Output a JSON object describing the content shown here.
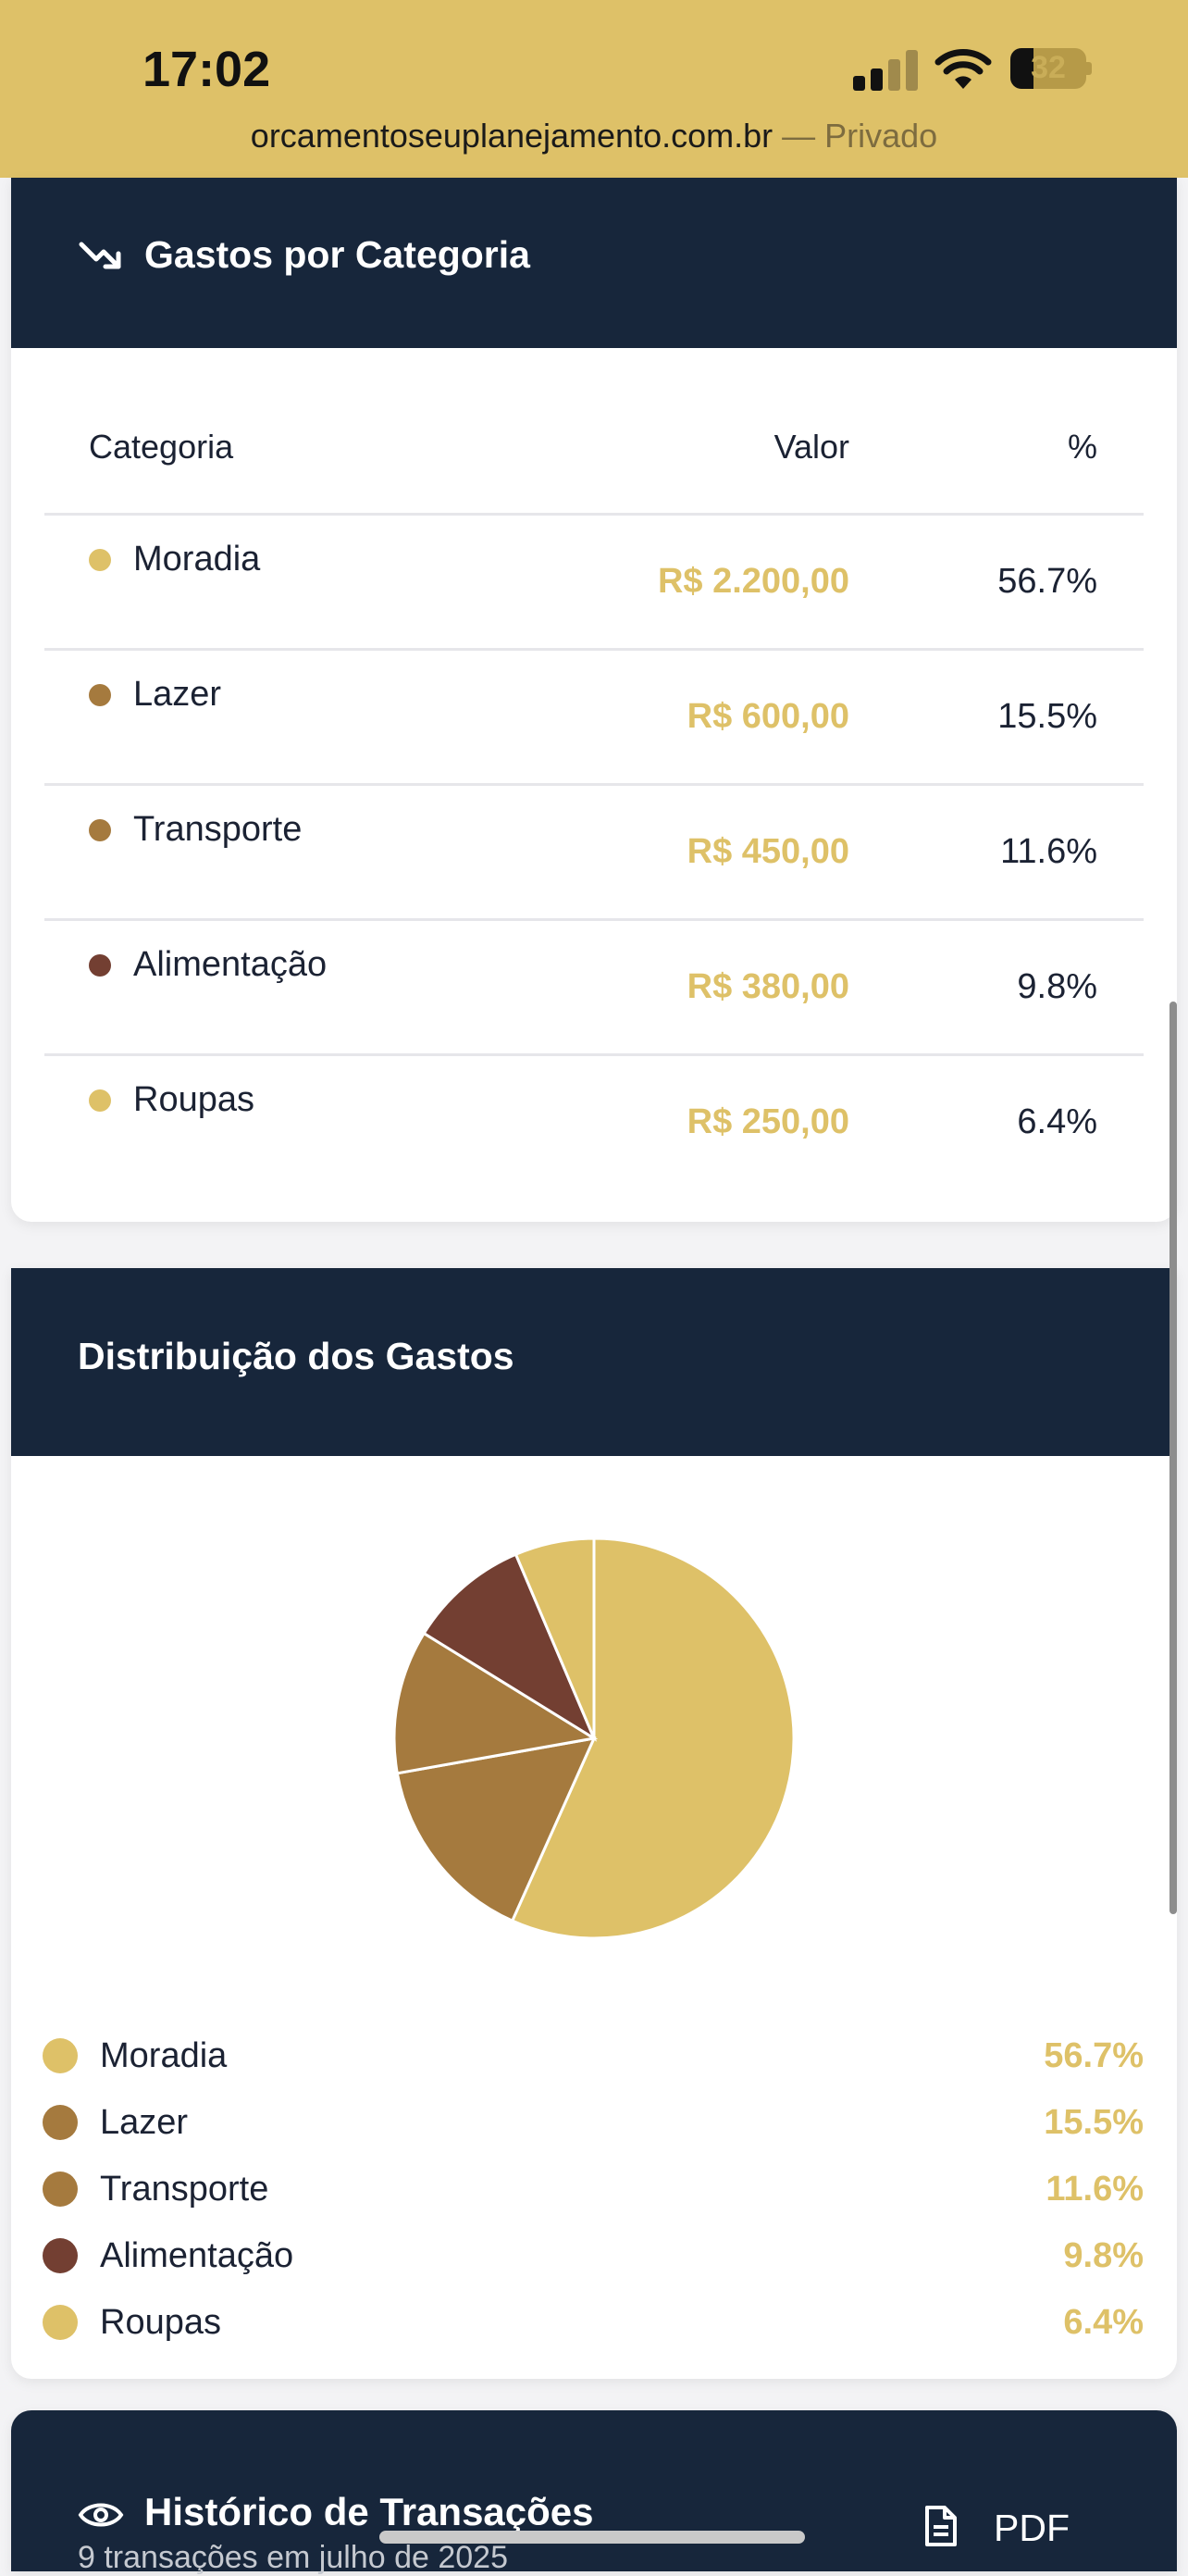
{
  "status_bar": {
    "time": "17:02",
    "battery": "32",
    "url": "orcamentoseuplanejamento.com.br",
    "private_label": "— Privado"
  },
  "category_card": {
    "title": "Gastos por Categoria",
    "icon": "trending-down-icon",
    "columns": {
      "category": "Categoria",
      "value": "Valor",
      "percent": "%"
    },
    "rows": [
      {
        "name": "Moradia",
        "value": "R$ 2.200,00",
        "percent": "56.7%",
        "color": "#dec168"
      },
      {
        "name": "Lazer",
        "value": "R$ 600,00",
        "percent": "15.5%",
        "color": "#a57a3e"
      },
      {
        "name": "Transporte",
        "value": "R$ 450,00",
        "percent": "11.6%",
        "color": "#a57a3e"
      },
      {
        "name": "Alimentação",
        "value": "R$ 380,00",
        "percent": "9.8%",
        "color": "#733f32"
      },
      {
        "name": "Roupas",
        "value": "R$ 250,00",
        "percent": "6.4%",
        "color": "#dec168"
      }
    ]
  },
  "distribution_card": {
    "title": "Distribuição dos Gastos",
    "legend": [
      {
        "name": "Moradia",
        "percent": "56.7%",
        "color": "#dec168"
      },
      {
        "name": "Lazer",
        "percent": "15.5%",
        "color": "#a57a3e"
      },
      {
        "name": "Transporte",
        "percent": "11.6%",
        "color": "#a57a3e"
      },
      {
        "name": "Alimentação",
        "percent": "9.8%",
        "color": "#733f32"
      },
      {
        "name": "Roupas",
        "percent": "6.4%",
        "color": "#dec168"
      }
    ]
  },
  "chart_data": {
    "type": "pie",
    "categories": [
      "Moradia",
      "Lazer",
      "Transporte",
      "Alimentação",
      "Roupas"
    ],
    "values": [
      56.7,
      15.5,
      11.6,
      9.8,
      6.4
    ],
    "colors": [
      "#dec168",
      "#a57a3e",
      "#a57a3e",
      "#733f32",
      "#dec168"
    ],
    "title": "Distribuição dos Gastos",
    "legend": "bottom"
  },
  "history_card": {
    "title": "Histórico de Transações",
    "subtitle": "9 transações  em julho de 2025",
    "icon": "eye-icon",
    "pdf_label": "PDF"
  },
  "colors": {
    "header_bg": "#17263b",
    "accent_gold": "#dec168",
    "status_bar_bg": "#dec168"
  }
}
